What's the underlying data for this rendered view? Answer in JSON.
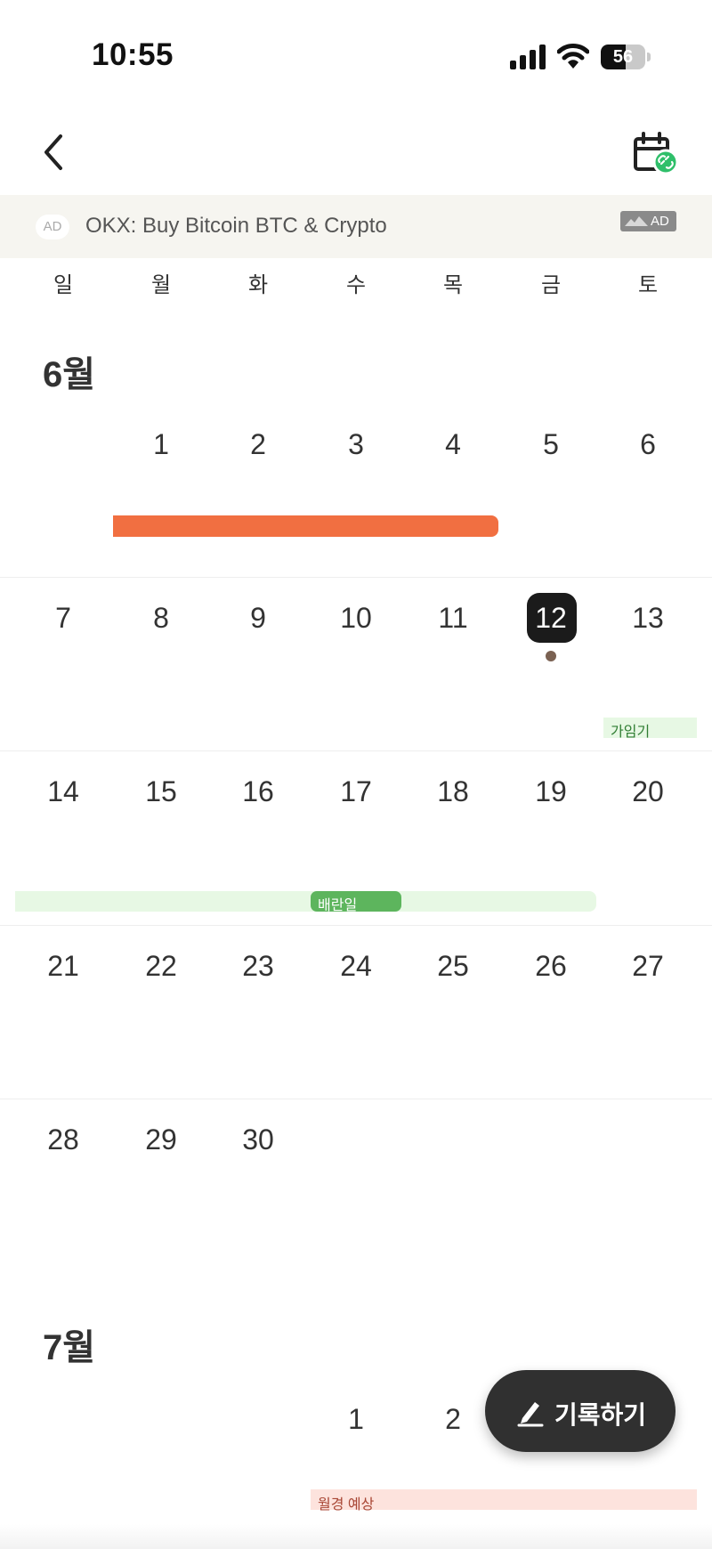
{
  "status_bar": {
    "time": "10:55",
    "battery_level": "56",
    "battery_fraction": 0.56
  },
  "header": {
    "back_icon": "chevron-left-icon",
    "calendar_icon": "calendar-link-icon",
    "calendar_badge_color": "#2fbf6a"
  },
  "ad": {
    "badge": "AD",
    "text": "OKX: Buy Bitcoin BTC & Crypto",
    "corner_label": "AD"
  },
  "weekdays": [
    "일",
    "월",
    "화",
    "수",
    "목",
    "금",
    "토"
  ],
  "calendar": {
    "today": "12",
    "months": [
      {
        "label": "6월",
        "days": [
          "1",
          "2",
          "3",
          "4",
          "5",
          "6",
          "7",
          "8",
          "9",
          "10",
          "11",
          "12",
          "13",
          "14",
          "15",
          "16",
          "17",
          "18",
          "19",
          "20",
          "21",
          "22",
          "23",
          "24",
          "25",
          "26",
          "27",
          "28",
          "29",
          "30"
        ]
      },
      {
        "label": "7월",
        "days": [
          "1",
          "2"
        ]
      }
    ]
  },
  "events": {
    "period_color": "#f16f41",
    "fertile_label": "가임기",
    "ovulation_label": "배란일",
    "predicted_label": "월경 예상"
  },
  "fab": {
    "label": "기록하기",
    "icon": "pencil-icon"
  }
}
